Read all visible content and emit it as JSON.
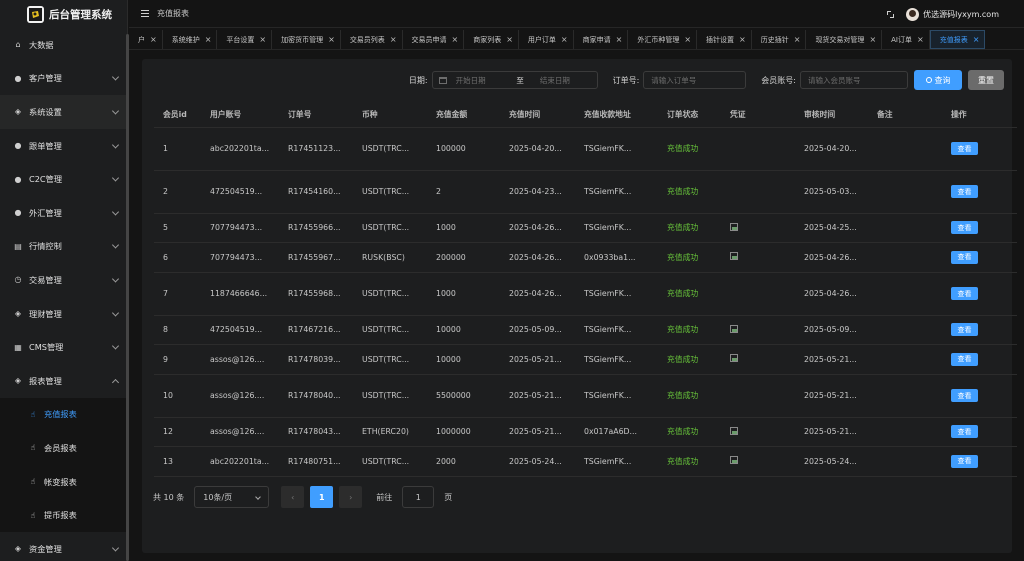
{
  "app": {
    "title": "后台管理系统"
  },
  "header": {
    "breadcrumb": "充值报表",
    "user_name": "优选源码lyxym.com"
  },
  "sidebar": {
    "items": [
      {
        "label": "大数据",
        "icon": "home-icon",
        "ico": "⌂"
      },
      {
        "label": "客户管理",
        "icon": "user-icon",
        "ico": "●",
        "arrow": true
      },
      {
        "label": "系统设置",
        "icon": "shield-icon",
        "ico": "◈",
        "arrow": true
      },
      {
        "label": "跟单管理",
        "icon": "user-icon",
        "ico": "●",
        "arrow": true
      },
      {
        "label": "C2C管理",
        "icon": "user-icon",
        "ico": "●",
        "arrow": true
      },
      {
        "label": "外汇管理",
        "icon": "user-icon",
        "ico": "●",
        "arrow": true
      },
      {
        "label": "行情控制",
        "icon": "document-icon",
        "ico": "▤",
        "arrow": true
      },
      {
        "label": "交易管理",
        "icon": "alarm-icon",
        "ico": "◷",
        "arrow": true
      },
      {
        "label": "理财管理",
        "icon": "shield-icon",
        "ico": "◈",
        "arrow": true
      },
      {
        "label": "CMS管理",
        "icon": "grid-icon",
        "ico": "▦",
        "arrow": true
      },
      {
        "label": "报表管理",
        "icon": "shield-icon",
        "ico": "◈",
        "arrow": true,
        "open": true
      },
      {
        "label": "充值报表",
        "icon": "thumb-icon",
        "ico": "☝",
        "sub": true,
        "active": true
      },
      {
        "label": "会员报表",
        "icon": "thumb-icon",
        "ico": "☝",
        "sub": true
      },
      {
        "label": "帐变报表",
        "icon": "thumb-icon",
        "ico": "☝",
        "sub": true
      },
      {
        "label": "提币报表",
        "icon": "thumb-icon",
        "ico": "☝",
        "sub": true
      },
      {
        "label": "资金管理",
        "icon": "shield-icon",
        "ico": "◈",
        "arrow": true
      }
    ]
  },
  "tabs": [
    {
      "label": "户"
    },
    {
      "label": "系统维护"
    },
    {
      "label": "平台设置"
    },
    {
      "label": "加密货币管理"
    },
    {
      "label": "交易员列表"
    },
    {
      "label": "交易员申请"
    },
    {
      "label": "商家列表"
    },
    {
      "label": "用户订单"
    },
    {
      "label": "商家申请"
    },
    {
      "label": "外汇币种管理"
    },
    {
      "label": "插针设置"
    },
    {
      "label": "历史插针"
    },
    {
      "label": "现货交易对管理"
    },
    {
      "label": "AI订单"
    },
    {
      "label": "充值报表",
      "active": true
    }
  ],
  "filter": {
    "date_label": "日期:",
    "start_placeholder": "开始日期",
    "range_separator": "至",
    "end_placeholder": "结束日期",
    "order_label": "订单号:",
    "order_placeholder": "请输入订单号",
    "account_label": "会员账号:",
    "account_placeholder": "请输入会员账号",
    "search_label": "查询",
    "reset_label": "重置"
  },
  "table": {
    "columns": [
      "会员id",
      "用户账号",
      "订单号",
      "币种",
      "充值金额",
      "充值时间",
      "充值收款地址",
      "订单状态",
      "凭证",
      "审核时间",
      "备注",
      "操作"
    ],
    "rows": [
      {
        "id": "1",
        "account": "abc202201ta...",
        "order": "R17451123...",
        "coin": "USDT(TRC...",
        "amount": "100000",
        "time": "2025-04-20...",
        "address": "TSGiemFK...",
        "status": "充值成功",
        "proof": false,
        "audit": "2025-04-20...",
        "remark": "",
        "action": "查看",
        "tall": true
      },
      {
        "id": "2",
        "account": "472504519...",
        "order": "R17454160...",
        "coin": "USDT(TRC...",
        "amount": "2",
        "time": "2025-04-23...",
        "address": "TSGiemFK...",
        "status": "充值成功",
        "proof": false,
        "audit": "2025-05-03...",
        "remark": "",
        "action": "查看",
        "tall": true
      },
      {
        "id": "5",
        "account": "707794473...",
        "order": "R17455966...",
        "coin": "USDT(TRC...",
        "amount": "1000",
        "time": "2025-04-26...",
        "address": "TSGiemFK...",
        "status": "充值成功",
        "proof": true,
        "audit": "2025-04-25...",
        "remark": "",
        "action": "查看",
        "tall": false
      },
      {
        "id": "6",
        "account": "707794473...",
        "order": "R17455967...",
        "coin": "RUSK(BSC)",
        "amount": "200000",
        "time": "2025-04-26...",
        "address": "0x0933ba1...",
        "status": "充值成功",
        "proof": true,
        "audit": "2025-04-26...",
        "remark": "",
        "action": "查看",
        "tall": false
      },
      {
        "id": "7",
        "account": "1187466646...",
        "order": "R17455968...",
        "coin": "USDT(TRC...",
        "amount": "1000",
        "time": "2025-04-26...",
        "address": "TSGiemFK...",
        "status": "充值成功",
        "proof": false,
        "audit": "2025-04-26...",
        "remark": "",
        "action": "查看",
        "tall": true
      },
      {
        "id": "8",
        "account": "472504519...",
        "order": "R17467216...",
        "coin": "USDT(TRC...",
        "amount": "10000",
        "time": "2025-05-09...",
        "address": "TSGiemFK...",
        "status": "充值成功",
        "proof": true,
        "audit": "2025-05-09...",
        "remark": "",
        "action": "查看",
        "tall": false
      },
      {
        "id": "9",
        "account": "assos@126....",
        "order": "R17478039...",
        "coin": "USDT(TRC...",
        "amount": "10000",
        "time": "2025-05-21...",
        "address": "TSGiemFK...",
        "status": "充值成功",
        "proof": true,
        "audit": "2025-05-21...",
        "remark": "",
        "action": "查看",
        "tall": false
      },
      {
        "id": "10",
        "account": "assos@126....",
        "order": "R17478040...",
        "coin": "USDT(TRC...",
        "amount": "5500000",
        "time": "2025-05-21...",
        "address": "TSGiemFK...",
        "status": "充值成功",
        "proof": false,
        "audit": "2025-05-21...",
        "remark": "",
        "action": "查看",
        "tall": true
      },
      {
        "id": "12",
        "account": "assos@126....",
        "order": "R17478043...",
        "coin": "ETH(ERC20)",
        "amount": "1000000",
        "time": "2025-05-21...",
        "address": "0x017aA6D...",
        "status": "充值成功",
        "proof": true,
        "audit": "2025-05-21...",
        "remark": "",
        "action": "查看",
        "tall": false
      },
      {
        "id": "13",
        "account": "abc202201ta...",
        "order": "R17480751...",
        "coin": "USDT(TRC...",
        "amount": "2000",
        "time": "2025-05-24...",
        "address": "TSGiemFK...",
        "status": "充值成功",
        "proof": true,
        "audit": "2025-05-24...",
        "remark": "",
        "action": "查看",
        "tall": false
      }
    ]
  },
  "pagination": {
    "total_label": "共 10 条",
    "page_size": "10条/页",
    "prev": "‹",
    "current_page": "1",
    "next": "›",
    "goto_label": "前往",
    "goto_value": "1",
    "page_suffix": "页"
  },
  "colors": {
    "accent": "#409eff",
    "success": "#67c23a",
    "background": "#141414",
    "panel": "#1d1e1f"
  }
}
